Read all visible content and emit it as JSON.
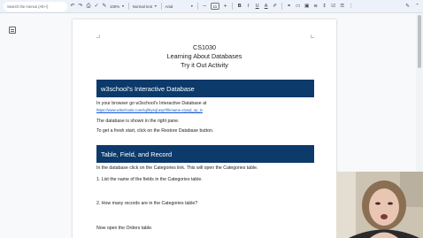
{
  "toolbar": {
    "search_placeholder": "Search the menus (Alt+/)",
    "zoom": "100%",
    "style": "Normal text",
    "font": "Arial",
    "font_size": "11"
  },
  "document": {
    "title_lines": [
      "CS1030",
      "Learning About Databases",
      "Try it Out Activity"
    ],
    "section1": {
      "heading": "w3school's Interactive Database",
      "line1": "In your browser go w3school's Interactive Database at",
      "link": "https://www.w3schools.com/sql/trysql.asp?filename=trysql_op_in",
      "line2": "The database is shown in the right pane.",
      "line3": "To get a fresh start, click on the Restore Database button."
    },
    "section2": {
      "heading": "Table, Field, and Record",
      "line1": "In the database click on the Categories link. This will open the Categories table.",
      "q1": "1.  List the name of the fields in the Categories table.",
      "q2": "2.  How many records are in the Categories table?",
      "line2": "Now open the Orders table."
    }
  }
}
